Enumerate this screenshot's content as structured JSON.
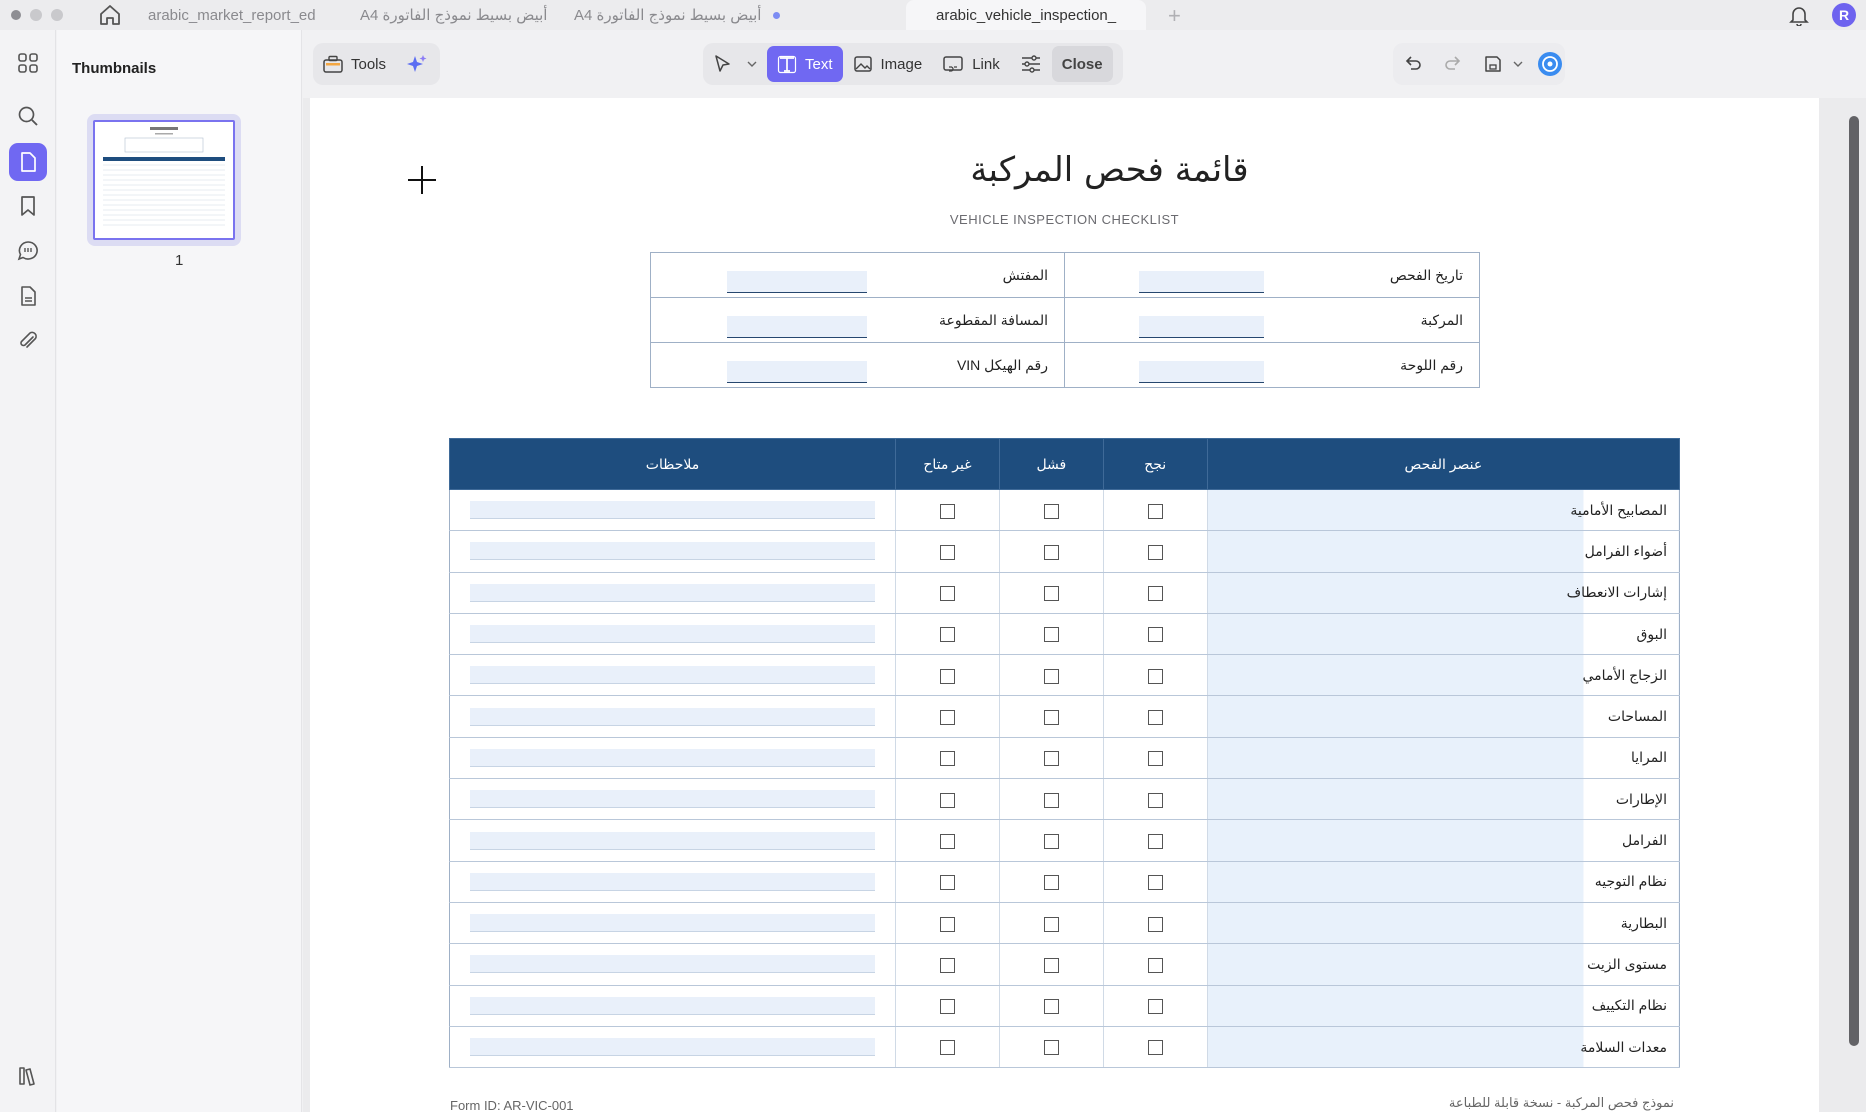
{
  "tabs": [
    {
      "label": "arabic_market_report_ed",
      "modified": false
    },
    {
      "label": "أبيض بسيط نموذج الفاتورة A4",
      "modified": false
    },
    {
      "label": "أبيض بسيط نموذج الفاتورة A4",
      "modified": true
    },
    {
      "label": "arabic_vehicle_inspection_",
      "modified": true,
      "active": true
    }
  ],
  "user": {
    "avatar_initial": "R"
  },
  "sidebar": {
    "title": "Thumbnails",
    "page_number": "1"
  },
  "toolbar": {
    "tools_label": "Tools",
    "text_label": "Text",
    "image_label": "Image",
    "link_label": "Link",
    "close_label": "Close"
  },
  "document": {
    "title": "قائمة فحص المركبة",
    "subtitle": "VEHICLE INSPECTION CHECKLIST",
    "info_rows": [
      {
        "right_label": "تاريخ الفحص",
        "left_label": "المفتش"
      },
      {
        "right_label": "المركبة",
        "left_label": "المسافة المقطوعة"
      },
      {
        "right_label": "رقم اللوحة",
        "left_label": "رقم الهيكل VIN"
      }
    ],
    "table_headers": {
      "item": "عنصر الفحص",
      "pass": "نجح",
      "fail": "فشل",
      "na": "غير متاح",
      "notes": "ملاحظات"
    },
    "items": [
      "المصابيح الأمامية",
      "أضواء الفرامل",
      "إشارات الانعطاف",
      "البوق",
      "الزجاج الأمامي",
      "المساحات",
      "المرايا",
      "الإطارات",
      "الفرامل",
      "نظام التوجيه",
      "البطارية",
      "مستوى الزيت",
      "نظام التكييف",
      "معدات السلامة"
    ],
    "footer_right": "نموذج فحص المركبة - نسخة قابلة للطباعة",
    "footer_left": "Form ID: AR-VIC-001"
  },
  "colors": {
    "accent": "#7068f2",
    "table_header": "#1e4d7e"
  }
}
